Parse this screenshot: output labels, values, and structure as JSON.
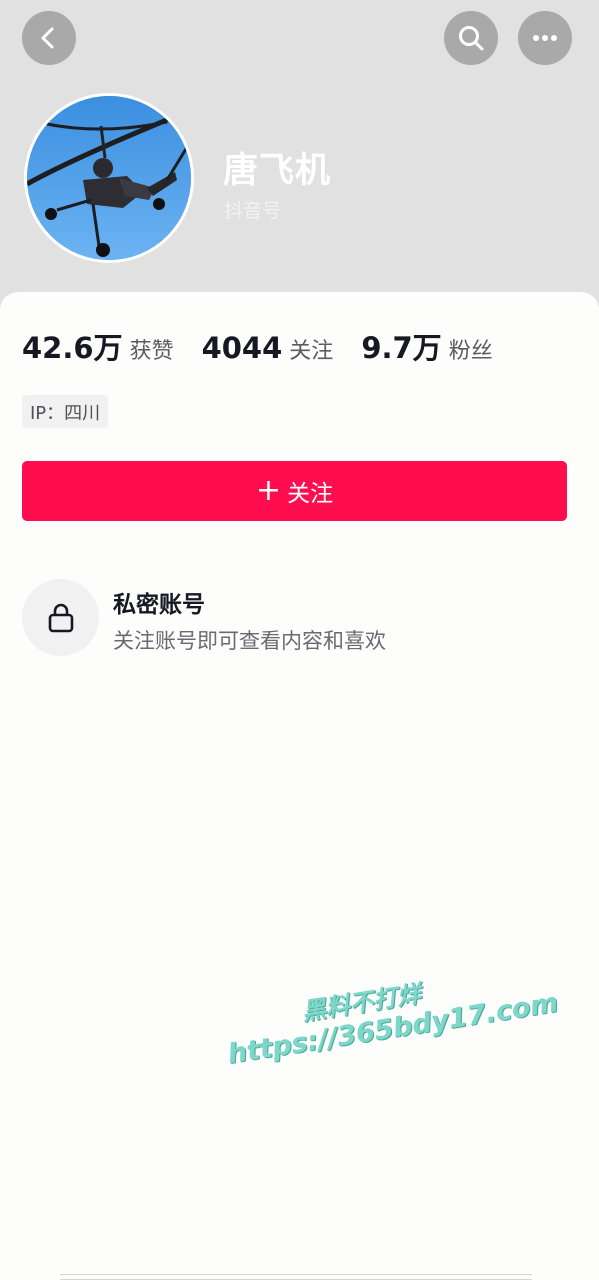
{
  "header": {
    "back_icon": "chevron-left-icon",
    "search_icon": "search-icon",
    "more_icon": "more-horizontal-icon"
  },
  "profile": {
    "name": "唐飞机",
    "handle_label": "抖音号"
  },
  "stats": [
    {
      "value": "42.6万",
      "label": "获赞"
    },
    {
      "value": "4044",
      "label": "关注"
    },
    {
      "value": "9.7万",
      "label": "粉丝"
    }
  ],
  "ip_tag": "IP：四川",
  "follow_button": {
    "plus": "+",
    "label": "关注"
  },
  "private": {
    "icon": "lock-icon",
    "title": "私密账号",
    "description": "关注账号即可查看内容和喜欢"
  },
  "watermark": {
    "line1": "黑料不打烊",
    "line2": "https://365bdy17.com"
  },
  "colors": {
    "accent": "#fe0d4f",
    "header_bg": "#e1e1e1",
    "watermark": "#7fd7c9"
  }
}
